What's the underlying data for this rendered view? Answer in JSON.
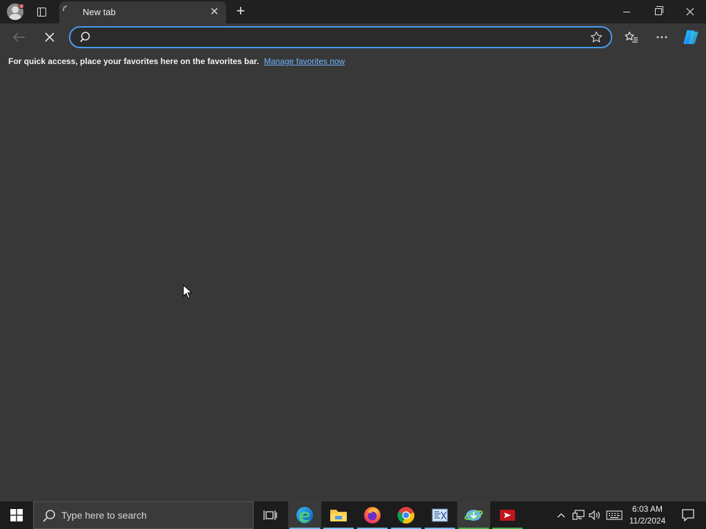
{
  "browser": {
    "tab": {
      "title": "New tab"
    },
    "address_bar": {
      "value": "",
      "placeholder": ""
    },
    "favorites_bar": {
      "message": "For quick access, place your favorites here on the favorites bar.",
      "link": "Manage favorites now"
    }
  },
  "taskbar": {
    "search_placeholder": "Type here to search",
    "pinned": [
      {
        "name": "task-view",
        "active": false
      },
      {
        "name": "microsoft-edge",
        "active": true
      },
      {
        "name": "file-explorer",
        "active": false
      },
      {
        "name": "firefox",
        "active": false
      },
      {
        "name": "chrome",
        "active": false
      },
      {
        "name": "registry-app",
        "active": false
      },
      {
        "name": "download-manager",
        "active": false
      },
      {
        "name": "anydesk",
        "active": false
      }
    ],
    "clock": {
      "time": "6:03 AM",
      "date": "11/2/2024"
    }
  },
  "colors": {
    "accent": "#4a9bef",
    "link": "#6cb4ff",
    "page_bg": "#383838",
    "tabstrip_bg": "#202020",
    "taskbar_bg": "#1c1c1c"
  }
}
